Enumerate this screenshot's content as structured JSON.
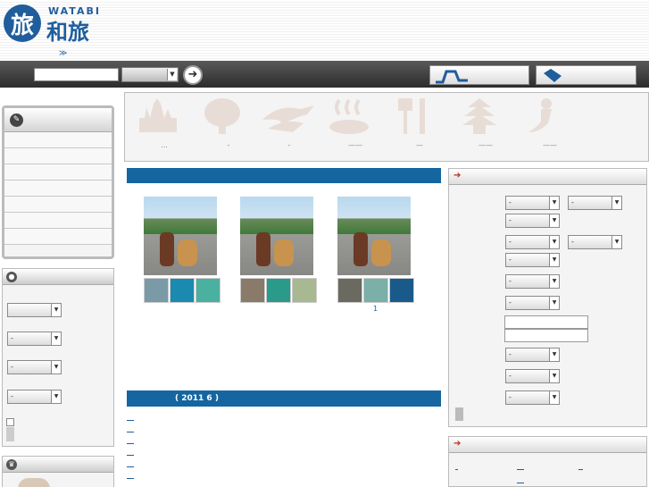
{
  "header": {
    "logo_mark": "旅",
    "logo_en": "WATABI",
    "logo_jp": "和旅",
    "breadcrumb_arrow": "≫"
  },
  "toolbar": {
    "search_value": "",
    "search_select": "",
    "go_icon": "arrow-right-circle",
    "button_a_label": "",
    "button_b_label": ""
  },
  "left": {
    "nav_items": [
      "",
      "",
      "",
      "",
      "",
      "",
      "",
      ""
    ],
    "filters": [
      "",
      "-",
      "-",
      "-"
    ]
  },
  "categories": [
    {
      "icon": "castle-icon",
      "label": "..."
    },
    {
      "icon": "tree-icon",
      "label": "-"
    },
    {
      "icon": "dolphin-icon",
      "label": "-"
    },
    {
      "icon": "hot-spring-icon",
      "label": "——"
    },
    {
      "icon": "fork-knife-icon",
      "label": "—"
    },
    {
      "icon": "pagoda-icon",
      "label": "——"
    },
    {
      "icon": "mermaid-icon",
      "label": "——"
    }
  ],
  "main": {
    "featured_title": "",
    "news_header": "( 2011   6   )",
    "page_number": "1"
  },
  "right": {
    "search_box_title": "",
    "selects": [
      "-",
      "-",
      "-",
      "-",
      "-",
      "-",
      "-",
      "-",
      "-",
      "-",
      "-"
    ],
    "second_box_title": ""
  },
  "colors": {
    "accent_blue": "#1565a0",
    "toolbar_dark": "#2c2c2c",
    "arrow_red": "#b03020"
  }
}
